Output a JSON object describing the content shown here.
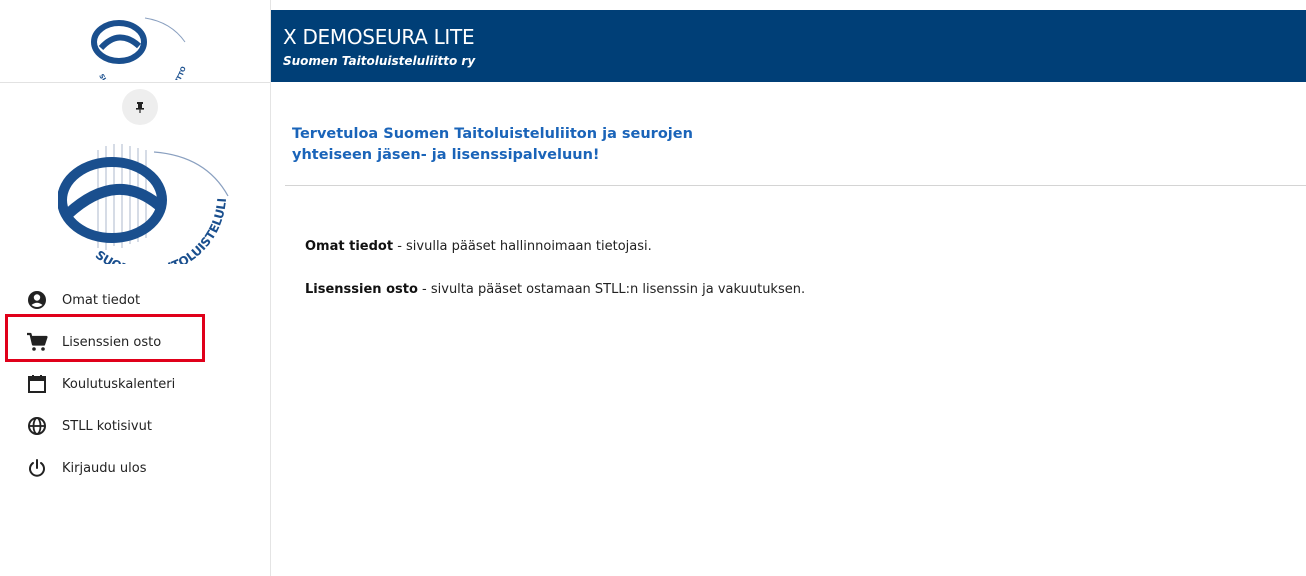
{
  "header": {
    "title": "X DEMOSEURA LITE",
    "subtitle": "Suomen Taitoluisteluliitto ry",
    "background_color": "#003f77"
  },
  "sidebar": {
    "logo_text": "SUOMEN TAITOLUISTELULIITTO",
    "pin_icon": "pin-icon",
    "items": [
      {
        "label": "Omat tiedot",
        "icon": "account-circle-icon"
      },
      {
        "label": "Lisenssien osto",
        "icon": "cart-icon"
      },
      {
        "label": "Koulutuskalenteri",
        "icon": "calendar-icon"
      },
      {
        "label": "STLL kotisivut",
        "icon": "globe-icon"
      },
      {
        "label": "Kirjaudu ulos",
        "icon": "power-icon"
      }
    ],
    "highlight_color": "#e0001a"
  },
  "main": {
    "welcome_line1": "Tervetuloa Suomen Taitoluisteluliiton ja seurojen",
    "welcome_line2": "yhteiseen jäsen- ja lisenssipalveluun!",
    "welcome_color": "#1a64b9",
    "info": [
      {
        "strong": "Omat tiedot",
        "text": " - sivulla pääset hallinnoimaan tietojasi."
      },
      {
        "strong": "Lisenssien osto",
        "text": " - sivulta pääset ostamaan STLL:n lisenssin ja vakuutuksen."
      }
    ]
  }
}
